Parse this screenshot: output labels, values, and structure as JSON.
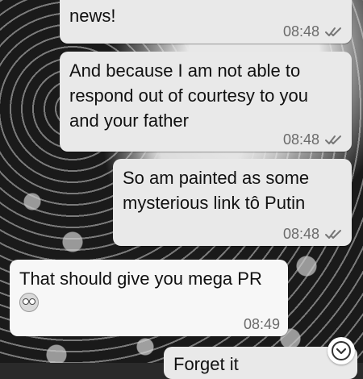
{
  "messages": [
    {
      "text": "news!",
      "time": "08:48",
      "direction": "outgoing",
      "read": true
    },
    {
      "text": "And because I am not able to respond out of courtesy to you and your father",
      "time": "08:48",
      "direction": "outgoing",
      "read": true
    },
    {
      "text": "So am painted as some mysterious link tô Putin",
      "time": "08:48",
      "direction": "outgoing",
      "read": true
    },
    {
      "text": "That should give you mega PR",
      "emoji": "flushed-face",
      "time": "08:49",
      "direction": "incoming"
    },
    {
      "text": "Forget it",
      "direction": "outgoing",
      "partial": true
    }
  ],
  "scroll_down_icon": "chevron-down-circle-icon"
}
